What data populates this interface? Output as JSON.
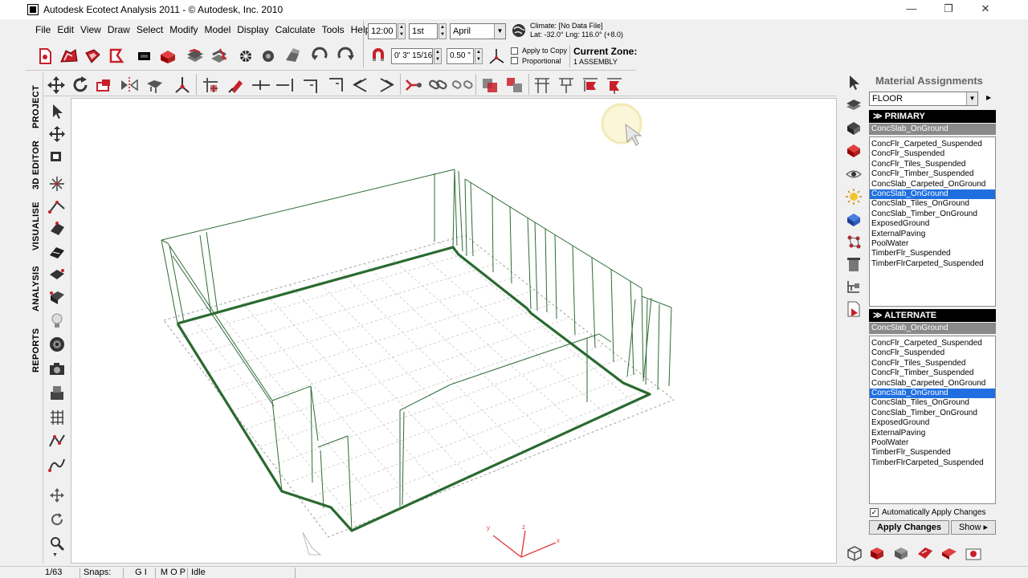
{
  "window": {
    "title": "Autodesk Ecotect Analysis 2011 - © Autodesk, Inc. 2010",
    "minimize": "—",
    "maximize": "❐",
    "close": "✕"
  },
  "menu": [
    "File",
    "Edit",
    "View",
    "Draw",
    "Select",
    "Modify",
    "Model",
    "Display",
    "Calculate",
    "Tools",
    "Help"
  ],
  "time_controls": {
    "time": "12:00",
    "day": "1st",
    "month": "April"
  },
  "climate": {
    "line1": "Climate: [No Data File]",
    "line2": "Lat: -32.0°   Lng: 116.0° (+8.0)"
  },
  "snap": {
    "offset": "0' 3\" 15/16",
    "angle": "0.50 \"",
    "apply_to_copy": "Apply to Copy",
    "proportional": "Proportional"
  },
  "current_zone": {
    "label": "Current Zone:",
    "value": "1 ASSEMBLY"
  },
  "left_tabs": [
    "PROJECT",
    "3D EDITOR",
    "VISUALISE",
    "ANALYSIS",
    "REPORTS"
  ],
  "panel": {
    "title": "Material Assignments",
    "element_type": "FLOOR",
    "primary_header": "PRIMARY",
    "primary_current": "ConcSlab_OnGround",
    "alternate_header": "ALTERNATE",
    "alternate_current": "ConcSlab_OnGround",
    "materials": [
      "ConcFlr_Carpeted_Suspended",
      "ConcFlr_Suspended",
      "ConcFlr_Tiles_Suspended",
      "ConcFlr_Timber_Suspended",
      "ConcSlab_Carpeted_OnGround",
      "ConcSlab_OnGround",
      "ConcSlab_Tiles_OnGround",
      "ConcSlab_Timber_OnGround",
      "ExposedGround",
      "ExternalPaving",
      "PoolWater",
      "TimberFlr_Suspended",
      "TimberFlrCarpeted_Suspended"
    ],
    "selected_index": 5,
    "auto_apply": "Automatically Apply Changes",
    "apply_button": "Apply Changes",
    "show_button": "Show ▸"
  },
  "axes": {
    "x": "x",
    "y": "y",
    "z": "z"
  },
  "status": {
    "count": "1/63",
    "snaps_label": "Snaps:",
    "snaps_gi": "G I",
    "snaps_mop": "M O P",
    "state": "Idle"
  },
  "colors": {
    "wall": "#2e6b34",
    "wall_base": "#2a6a30",
    "grid": "#a0a0a0",
    "selection": "#1f6fe0",
    "icon_red": "#c8202a"
  }
}
